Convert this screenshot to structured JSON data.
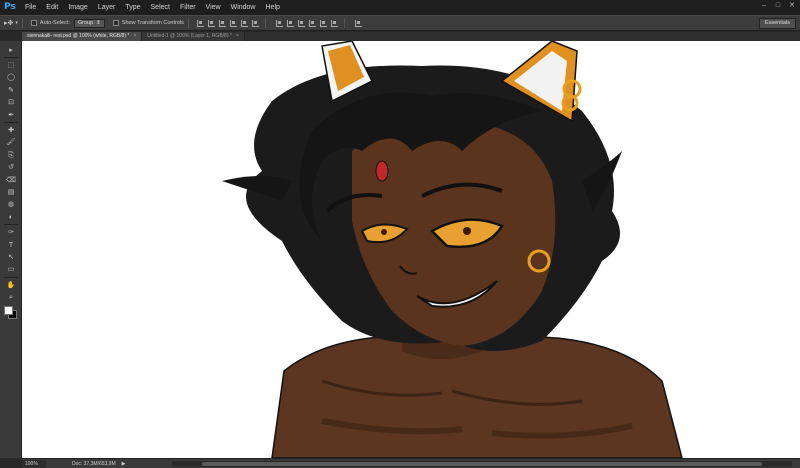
{
  "app": {
    "logo": "Ps"
  },
  "menu": [
    "File",
    "Edit",
    "Image",
    "Layer",
    "Type",
    "Select",
    "Filter",
    "View",
    "Window",
    "Help"
  ],
  "window_controls": [
    "minimize-icon",
    "maximize-icon",
    "close-icon"
  ],
  "options": {
    "auto_select_label": "Auto-Select:",
    "auto_select_value": "Group",
    "show_transform_label": "Show Transform Controls",
    "workspace": "Essentials"
  },
  "tabs": [
    {
      "label": "siennakaili- rest.psd @ 100% (white, RGB/8) *",
      "active": true
    },
    {
      "label": "Untitled-1 @ 100% (Layer 1, RGB/8) *",
      "active": false
    }
  ],
  "tools": [
    "move-icon",
    "marquee-icon",
    "lasso-icon",
    "quick-select-icon",
    "crop-icon",
    "eyedropper-icon",
    "healing-icon",
    "brush-icon",
    "clone-stamp-icon",
    "history-brush-icon",
    "eraser-icon",
    "gradient-icon",
    "blur-icon",
    "dodge-icon",
    "pen-icon",
    "type-icon",
    "path-select-icon",
    "shape-icon",
    "hand-icon",
    "zoom-icon"
  ],
  "tool_glyphs": [
    "▸",
    "⬚",
    "◯",
    "✎",
    "⊡",
    "✒",
    "✚",
    "🖌",
    "⎘",
    "↺",
    "⌫",
    "▤",
    "◍",
    "◐",
    "✑",
    "T",
    "↖",
    "▭",
    "✋",
    "⌕"
  ],
  "colors": {
    "foreground": "#ffffff",
    "background": "#000000",
    "canvas": "#ffffff",
    "accent": "#31a8ff"
  },
  "status": {
    "zoom": "100%",
    "doc": "Doc: 37,3M/653,9M"
  }
}
